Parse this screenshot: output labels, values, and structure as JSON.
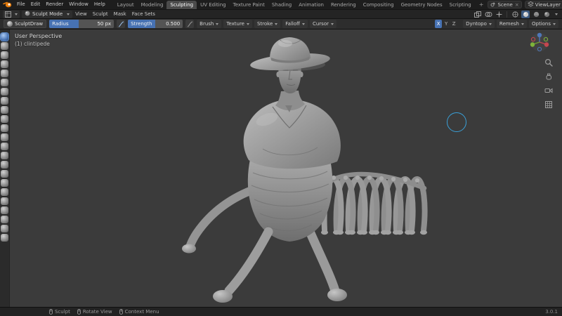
{
  "topbar": {
    "menus": [
      "File",
      "Edit",
      "Render",
      "Window",
      "Help"
    ],
    "workspaces": [
      {
        "label": "Layout"
      },
      {
        "label": "Modeling"
      },
      {
        "label": "Sculpting",
        "active": true
      },
      {
        "label": "UV Editing"
      },
      {
        "label": "Texture Paint"
      },
      {
        "label": "Shading"
      },
      {
        "label": "Animation"
      },
      {
        "label": "Rendering"
      },
      {
        "label": "Compositing"
      },
      {
        "label": "Geometry Nodes"
      },
      {
        "label": "Scripting"
      }
    ],
    "add_workspace": "+",
    "scene_label": "Scene",
    "view_layer_label": "ViewLayer"
  },
  "viewport_header": {
    "mode_label": "Sculpt Mode",
    "menus": [
      "View",
      "Sculpt",
      "Mask",
      "Face Sets"
    ]
  },
  "tool_settings": {
    "tool_name": "SculptDraw",
    "radius_label": "Radius",
    "radius_value": "50 px",
    "strength_label": "Strength",
    "strength_value": "0.500",
    "dropdowns": [
      "Brush",
      "Texture",
      "Stroke",
      "Falloff",
      "Cursor"
    ],
    "symmetry": [
      {
        "label": "X",
        "active": true
      },
      {
        "label": "Y"
      },
      {
        "label": "Z"
      }
    ],
    "panels": [
      "Dyntopo",
      "Remesh",
      "Options"
    ]
  },
  "left_toolbar": {
    "tools": [
      {
        "name": "draw",
        "active": true
      },
      {
        "name": "draw-sharp"
      },
      {
        "name": "clay"
      },
      {
        "name": "clay-strips"
      },
      {
        "name": "clay-thumb"
      },
      {
        "name": "layer"
      },
      {
        "name": "inflate"
      },
      {
        "name": "blob"
      },
      {
        "name": "crease"
      },
      {
        "name": "smooth"
      },
      {
        "name": "flatten"
      },
      {
        "name": "fill"
      },
      {
        "name": "scrape"
      },
      {
        "name": "multiplane-scrape"
      },
      {
        "name": "pinch"
      },
      {
        "name": "grab"
      },
      {
        "name": "elastic-deform"
      },
      {
        "name": "snake-hook"
      },
      {
        "name": "thumb"
      },
      {
        "name": "pose"
      },
      {
        "name": "nudge"
      },
      {
        "name": "rotate"
      },
      {
        "name": "slide-relax"
      }
    ]
  },
  "viewport": {
    "view_label": "User Perspective",
    "object_label": "(1) clintipede"
  },
  "statusbar": {
    "hints": [
      {
        "label": "Sculpt"
      },
      {
        "label": "Rotate View"
      },
      {
        "label": "Context Menu"
      }
    ],
    "version": "3.0.1"
  },
  "colors": {
    "accent": "#4772b3",
    "brush_cursor": "#3aa0d8"
  }
}
